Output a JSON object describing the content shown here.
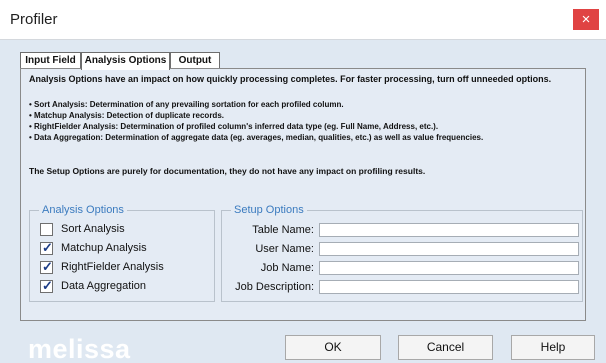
{
  "window": {
    "title": "Profiler",
    "close_glyph": "×"
  },
  "tabs": [
    {
      "label": "Input Field",
      "active": false
    },
    {
      "label": "Analysis Options",
      "active": true
    },
    {
      "label": "Output",
      "active": false
    }
  ],
  "info": {
    "intro": "Analysis Options have an impact on how quickly processing completes. For faster processing, turn off unneeded options.",
    "bullets": [
      "• Sort Analysis: Determination of any prevailing sortation for each profiled column.",
      "• Matchup Analysis: Detection of duplicate records.",
      "• RightFielder Analysis: Determination of profiled column's inferred data type (eg. Full Name, Address, etc.).",
      "• Data Aggregation: Determination of aggregate data (eg. averages, median, qualities, etc.) as well as value frequencies."
    ],
    "setup_note": "The Setup Options are purely for documentation, they do not have any impact on profiling results."
  },
  "analysis_options": {
    "title": "Analysis Options",
    "check_glyph": "✓",
    "items": [
      {
        "label": "Sort Analysis",
        "checked": false
      },
      {
        "label": "Matchup Analysis",
        "checked": true
      },
      {
        "label": "RightFielder Analysis",
        "checked": true
      },
      {
        "label": "Data Aggregation",
        "checked": true
      }
    ]
  },
  "setup_options": {
    "title": "Setup Options",
    "fields": [
      {
        "label": "Table Name:",
        "value": ""
      },
      {
        "label": "User Name:",
        "value": ""
      },
      {
        "label": "Job Name:",
        "value": ""
      },
      {
        "label": "Job Description:",
        "value": ""
      }
    ]
  },
  "footer": {
    "brand": "melissa",
    "ok_label": "OK",
    "cancel_label": "Cancel",
    "help_label": "Help"
  },
  "colors": {
    "background": "#dfe8f2",
    "close_button": "#e04343",
    "group_title": "#3b7bbf",
    "checkmark": "#1c3c86"
  }
}
